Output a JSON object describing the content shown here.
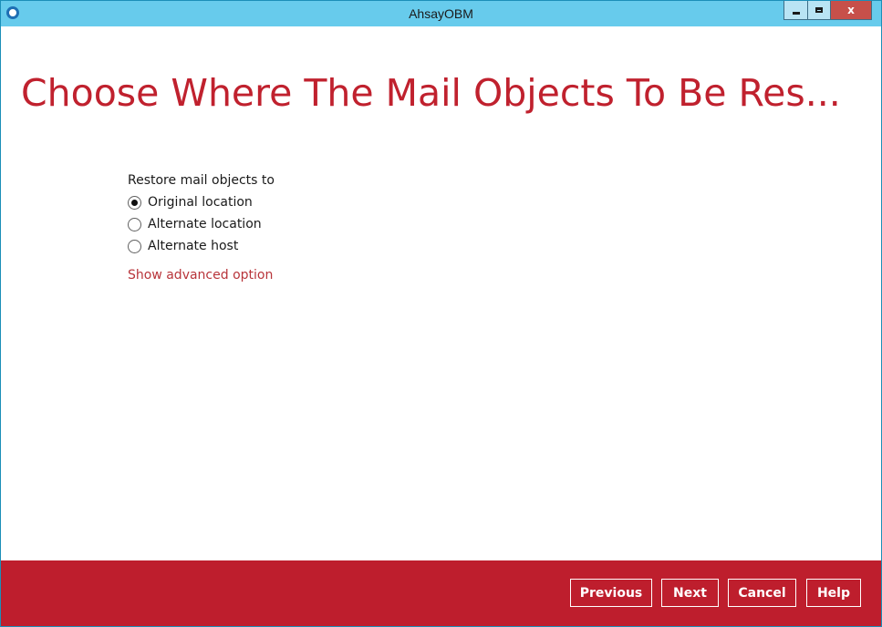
{
  "window": {
    "title": "AhsayOBM"
  },
  "title_bar": {
    "app_icon": "ahsay-logo-icon",
    "controls": {
      "minimize": "minimize-icon",
      "maximize": "maximize-icon",
      "close_label": "x"
    }
  },
  "main": {
    "heading": "Choose Where The Mail Objects To Be Res...",
    "restore_group_label": "Restore mail objects to",
    "options": [
      {
        "label": "Original location",
        "selected": true
      },
      {
        "label": "Alternate location",
        "selected": false
      },
      {
        "label": "Alternate host",
        "selected": false
      }
    ],
    "advanced_link": "Show advanced option"
  },
  "footer": {
    "previous_label": "Previous",
    "next_label": "Next",
    "cancel_label": "Cancel",
    "help_label": "Help"
  },
  "colors": {
    "title_bar": "#67cbec",
    "accent_red": "#be1e2d",
    "heading_red": "#c0212e",
    "link_red": "#b8343a"
  }
}
